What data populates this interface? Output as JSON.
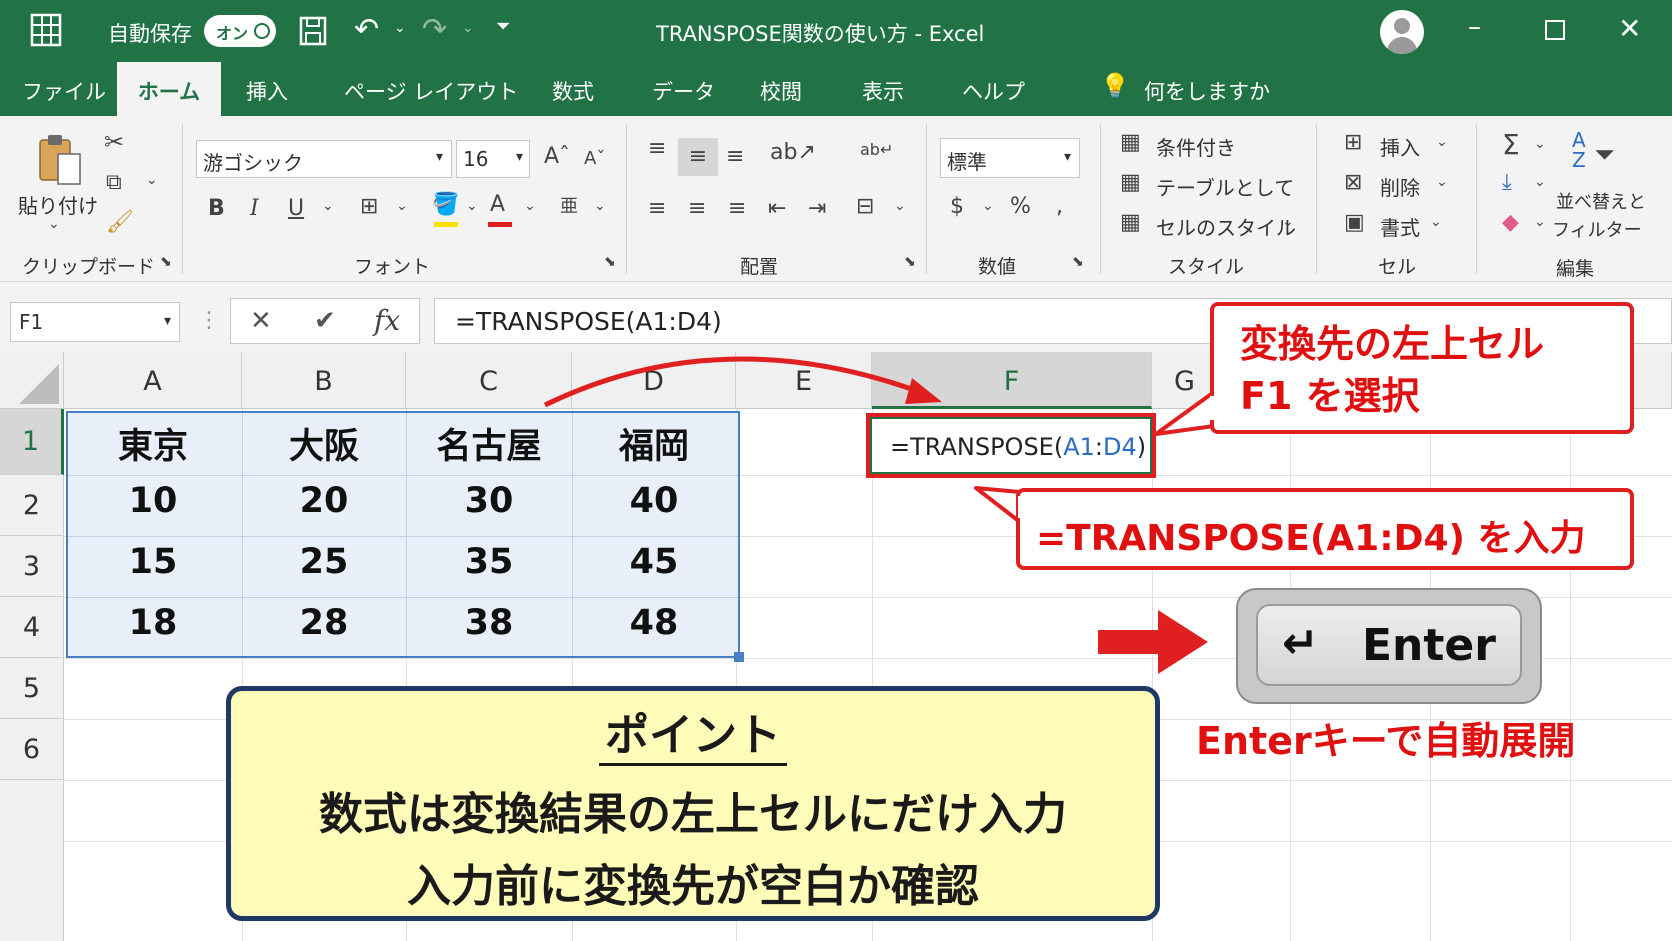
{
  "titlebar": {
    "autosave_label": "自動保存",
    "autosave_state": "オン",
    "title": "TRANSPOSE関数の使い方 - Excel"
  },
  "tabs": {
    "file": "ファイル",
    "home": "ホーム",
    "insert": "挿入",
    "layout": "ページ レイアウト",
    "formulas": "数式",
    "data": "データ",
    "review": "校閲",
    "view": "表示",
    "help": "ヘルプ",
    "tellme": "何をしますか"
  },
  "ribbon": {
    "clipboard": {
      "paste": "貼り付け",
      "group": "クリップボード"
    },
    "font": {
      "name": "游ゴシック",
      "size": "16",
      "bold": "B",
      "italic": "I",
      "underline": "U",
      "group": "フォント"
    },
    "alignment": {
      "group": "配置"
    },
    "number": {
      "format": "標準",
      "group": "数値"
    },
    "styles": {
      "conditional": "条件付き",
      "table": "テーブルとして",
      "cell_styles": "セルのスタイル",
      "group": "スタイル"
    },
    "cells": {
      "insert": "挿入",
      "delete": "削除",
      "format": "書式",
      "group": "セル"
    },
    "editing": {
      "sort_line1": "並べ替えと",
      "sort_line2": "フィルター",
      "group": "編集"
    }
  },
  "formula_bar": {
    "name_box": "F1",
    "fx": "fx",
    "formula": "=TRANSPOSE(A1:D4)"
  },
  "sheet": {
    "columns": [
      "A",
      "B",
      "C",
      "D",
      "E",
      "F",
      "G"
    ],
    "rows": [
      "1",
      "2",
      "3",
      "4",
      "5",
      "6"
    ],
    "data": [
      [
        "東京",
        "大阪",
        "名古屋",
        "福岡"
      ],
      [
        "10",
        "20",
        "30",
        "40"
      ],
      [
        "15",
        "25",
        "35",
        "45"
      ],
      [
        "18",
        "28",
        "38",
        "48"
      ]
    ],
    "active_cell": {
      "prefix": "=TRANSPOSE(",
      "ref1": "A1",
      "colon": ":",
      "ref2": "D4",
      "suffix": ")"
    }
  },
  "callouts": {
    "select_line1": "変換先の左上セル",
    "select_line2": "F1 を選択",
    "input": "=TRANSPOSE(A1:D4) を入力",
    "enter_key": "Enter",
    "enter_caption": "Enterキーで自動展開"
  },
  "point_box": {
    "title": "ポイント",
    "line1": "数式は変換結果の左上セルにだけ入力",
    "line2": "入力前に変換先が空白か確認"
  },
  "colors": {
    "excel_green": "#217346",
    "callout_red": "#e02020",
    "point_fill": "#fffbb8",
    "point_border": "#1f3864",
    "range_fill": "#e9eff8",
    "range_border": "#4a7fc8"
  }
}
